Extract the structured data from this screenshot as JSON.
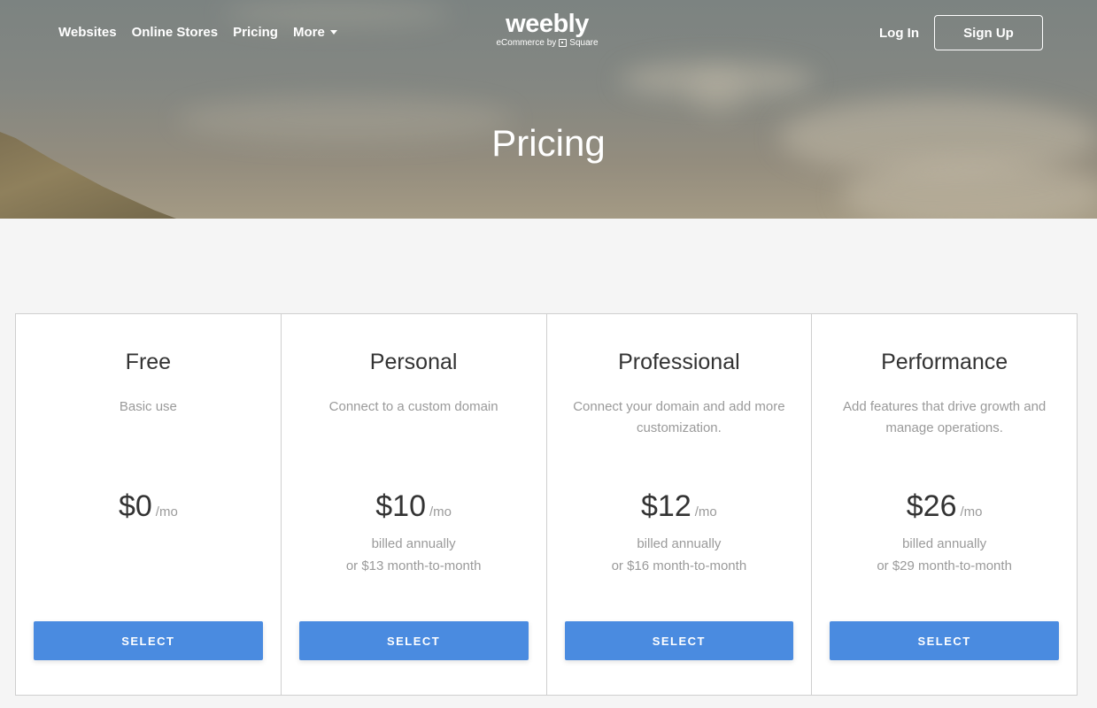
{
  "nav": {
    "links": [
      {
        "label": "Websites"
      },
      {
        "label": "Online Stores"
      },
      {
        "label": "Pricing"
      },
      {
        "label": "More",
        "icon": "caret-down-icon"
      }
    ],
    "login_label": "Log In",
    "signup_label": "Sign Up"
  },
  "logo": {
    "wordmark": "weebly",
    "tagline_prefix": "eCommerce by",
    "tagline_brand": "Square",
    "tagline_icon": "square-logo-icon"
  },
  "hero": {
    "title": "Pricing"
  },
  "plans": [
    {
      "name": "Free",
      "description": "Basic use",
      "price": "$0",
      "period": "/mo",
      "billing_line1": "",
      "billing_line2": "",
      "button_label": "SELECT"
    },
    {
      "name": "Personal",
      "description": "Connect to a custom domain",
      "price": "$10",
      "period": "/mo",
      "billing_line1": "billed annually",
      "billing_line2": "or $13 month-to-month",
      "button_label": "SELECT"
    },
    {
      "name": "Professional",
      "description": "Connect your domain and add more customization.",
      "price": "$12",
      "period": "/mo",
      "billing_line1": "billed annually",
      "billing_line2": "or $16 month-to-month",
      "button_label": "SELECT"
    },
    {
      "name": "Performance",
      "description": "Add features that drive growth and manage operations.",
      "price": "$26",
      "period": "/mo",
      "billing_line1": "billed annually",
      "billing_line2": "or $29 month-to-month",
      "button_label": "SELECT"
    }
  ],
  "colors": {
    "accent": "#4a8be0",
    "heading_text": "#333333",
    "muted_text": "#9a9a9a",
    "page_background": "#f5f5f5",
    "card_border": "#cfcfcf"
  }
}
